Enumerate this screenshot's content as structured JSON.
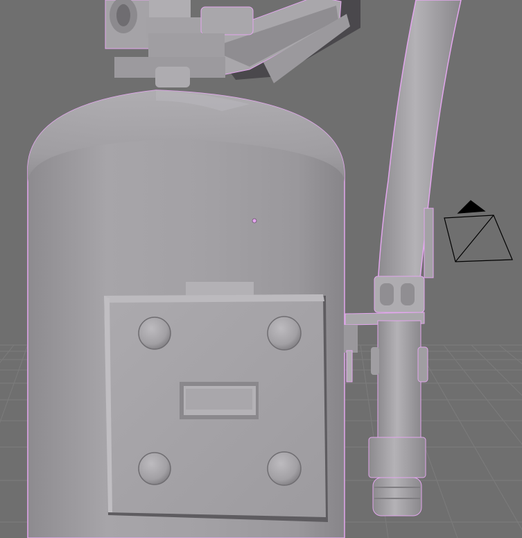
{
  "viewport": {
    "background_color": "#6f6f6f",
    "grid_color": "#808080",
    "model_color": "#a9a7ab",
    "outline_color": "#e3a6ee",
    "camera_color": "#000000"
  },
  "scene": {
    "objects": [
      {
        "name": "fire-extinguisher-body",
        "selected": true
      },
      {
        "name": "hose",
        "selected": true
      },
      {
        "name": "wall-mount-plate",
        "selected": true
      }
    ],
    "icons": [
      "camera-gizmo-icon",
      "object-origin-icon",
      "mount-screw-icon"
    ]
  }
}
